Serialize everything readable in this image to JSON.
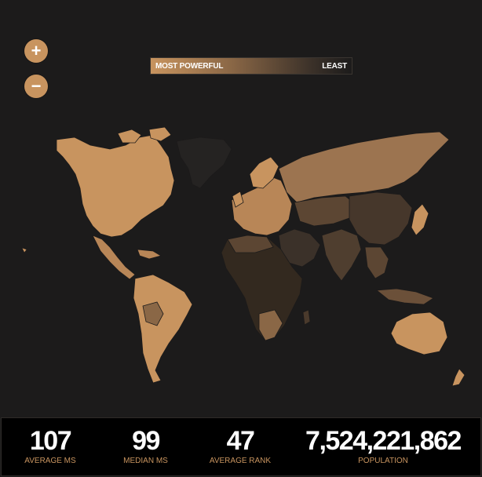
{
  "zoom": {
    "in_label": "+",
    "out_label": "−"
  },
  "legend": {
    "most_label": "MOST POWERFUL",
    "least_label": "LEAST"
  },
  "colors": {
    "background": "#1c1b1b",
    "most_powerful": "#c8945f",
    "least_powerful": "#1c1b1b",
    "stat_value": "#ffffff",
    "stat_label": "#c8945f"
  },
  "stats": [
    {
      "value": "107",
      "label": "AVERAGE MS"
    },
    {
      "value": "99",
      "label": "MEDIAN MS"
    },
    {
      "value": "47",
      "label": "AVERAGE RANK"
    },
    {
      "value": "7,524,221,862",
      "label": "POPULATION"
    }
  ]
}
